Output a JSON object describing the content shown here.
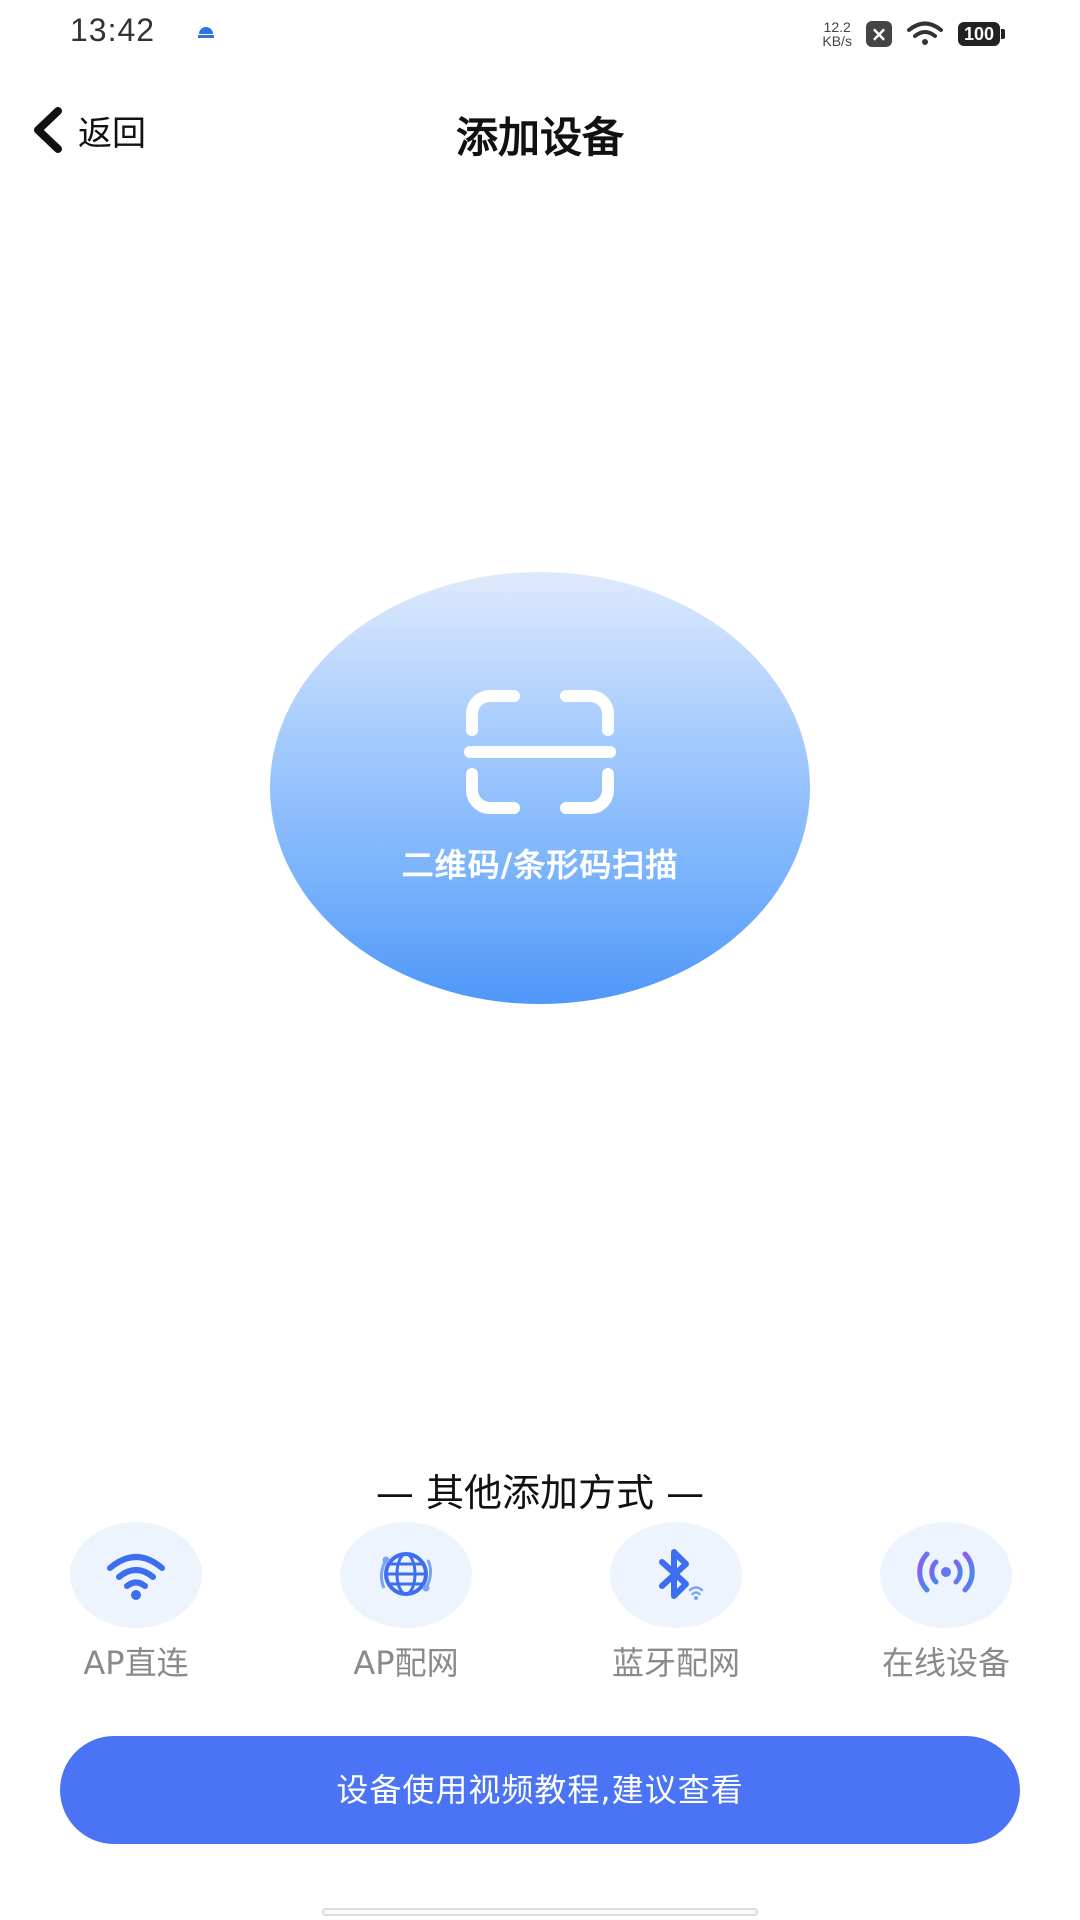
{
  "status_bar": {
    "time": "13:42",
    "net_speed_value": "12.2",
    "net_speed_unit": "KB/s",
    "battery": "100"
  },
  "header": {
    "back_label": "返回",
    "title": "添加设备"
  },
  "scan": {
    "label": "二维码/条形码扫描"
  },
  "other_methods": {
    "title": "— 其他添加方式 —",
    "items": [
      {
        "label": "AP直连",
        "icon": "wifi-icon"
      },
      {
        "label": "AP配网",
        "icon": "globe-network-icon"
      },
      {
        "label": "蓝牙配网",
        "icon": "bluetooth-icon"
      },
      {
        "label": "在线设备",
        "icon": "broadcast-icon"
      }
    ]
  },
  "tutorial_button": {
    "label": "设备使用视频教程,建议查看"
  },
  "colors": {
    "accent": "#4a74f5",
    "method_bg": "#eef4fd",
    "method_label": "#8a8a8a"
  }
}
